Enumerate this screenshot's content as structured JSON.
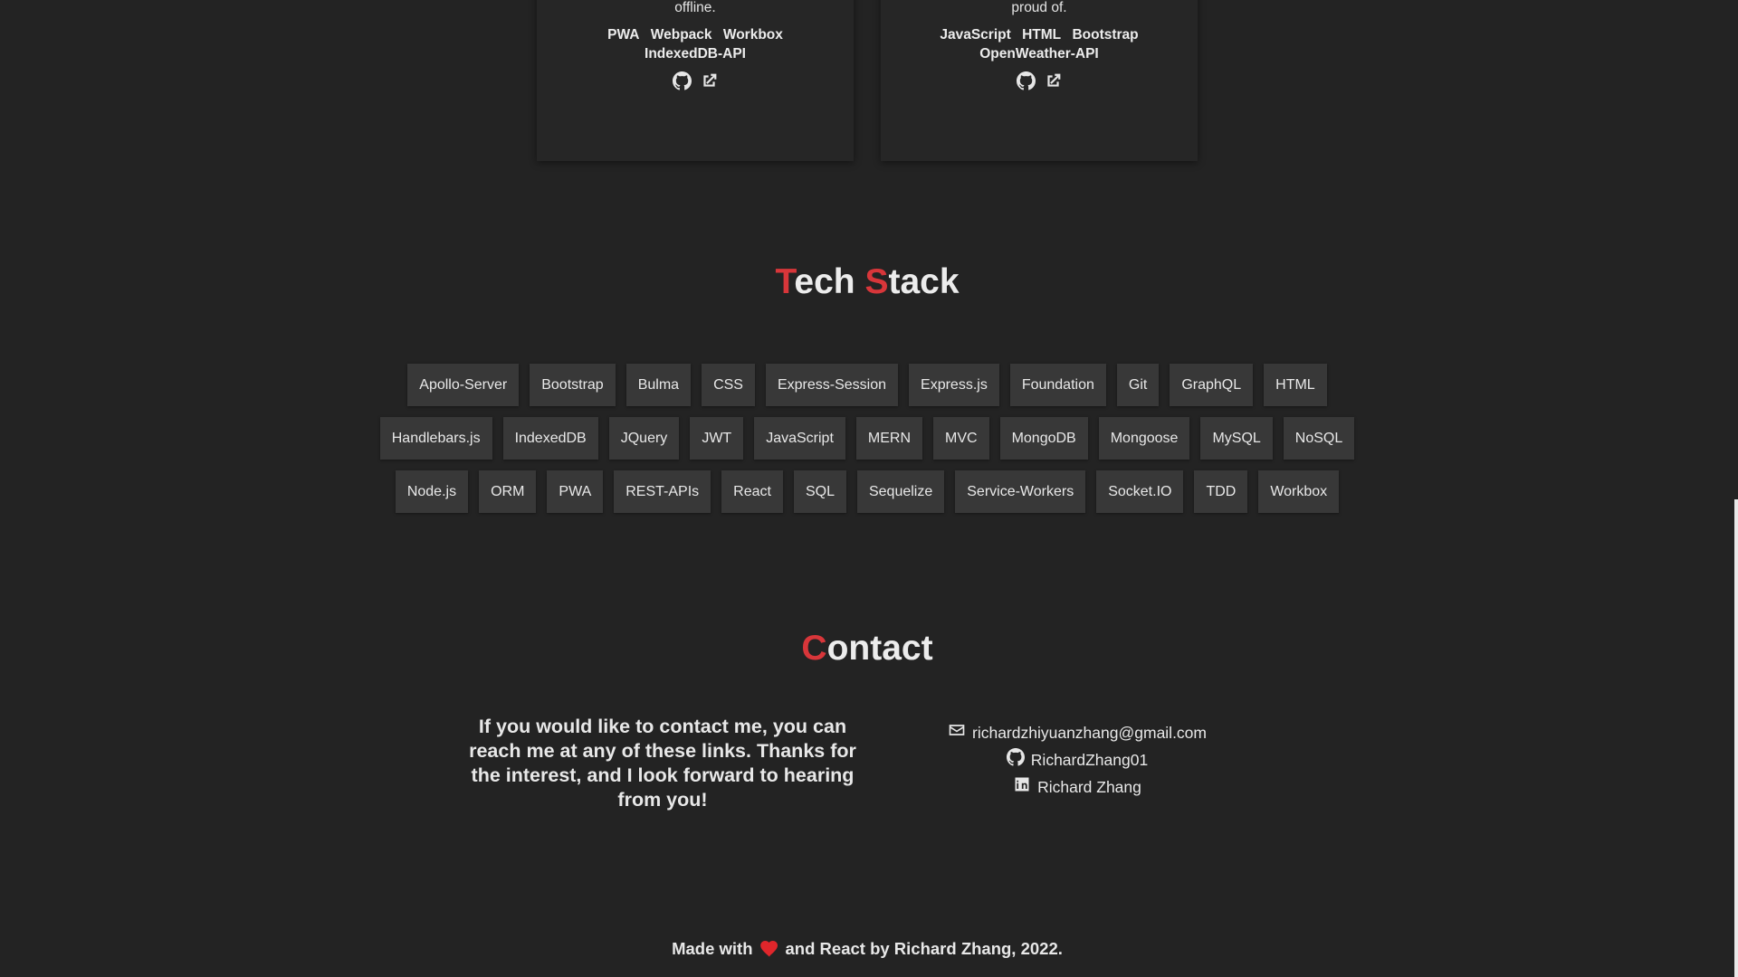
{
  "projects": [
    {
      "description": "criteria. This app features data persistence techniques that serve as redundancy, is downloadable, and additionally functions offline.",
      "techs": [
        "PWA",
        "Webpack",
        "Workbox",
        "IndexedDB-API"
      ],
      "icons": [
        "github-icon",
        "external-link-icon"
      ]
    },
    {
      "description": "the world. This is a front-end application, and was developed after 3 weeks of learning to code. It's also the first application that I was proud of.",
      "techs": [
        "JavaScript",
        "HTML",
        "Bootstrap",
        "OpenWeather-API"
      ],
      "icons": [
        "github-icon",
        "external-link-icon"
      ]
    }
  ],
  "tech_stack": {
    "title_first_letter": "T",
    "title_rest1": "ech ",
    "title_second_letter": "S",
    "title_rest2": "tack",
    "rows": [
      [
        "Apollo-Server",
        "Bootstrap",
        "Bulma",
        "CSS",
        "Express-Session",
        "Express.js",
        "Foundation",
        "Git",
        "GraphQL",
        "HTML"
      ],
      [
        "Handlebars.js",
        "IndexedDB",
        "JQuery",
        "JWT",
        "JavaScript",
        "MERN",
        "MVC",
        "MongoDB",
        "Mongoose",
        "MySQL",
        "NoSQL"
      ],
      [
        "Node.js",
        "ORM",
        "PWA",
        "REST-APIs",
        "React",
        "SQL",
        "Sequelize",
        "Service-Workers",
        "Socket.IO",
        "TDD",
        "Workbox"
      ]
    ]
  },
  "contact": {
    "title_first_letter": "C",
    "title_rest": "ontact",
    "message": "If you would like to contact me, you can reach me at any of these links. Thanks for the interest, and I look forward to hearing from you!",
    "links": [
      {
        "icon": "envelope-icon",
        "text": "richardzhiyuanzhang@gmail.com"
      },
      {
        "icon": "github-icon",
        "text": "RichardZhang01"
      },
      {
        "icon": "linkedin-icon",
        "text": "Richard Zhang"
      }
    ]
  },
  "footer": {
    "prefix": "Made with",
    "suffix": "and React by Richard Zhang, 2022."
  },
  "colors": {
    "background": "#232323",
    "accent": "#d8363a",
    "heart": "#e0262b",
    "tag_background": "#383838"
  }
}
